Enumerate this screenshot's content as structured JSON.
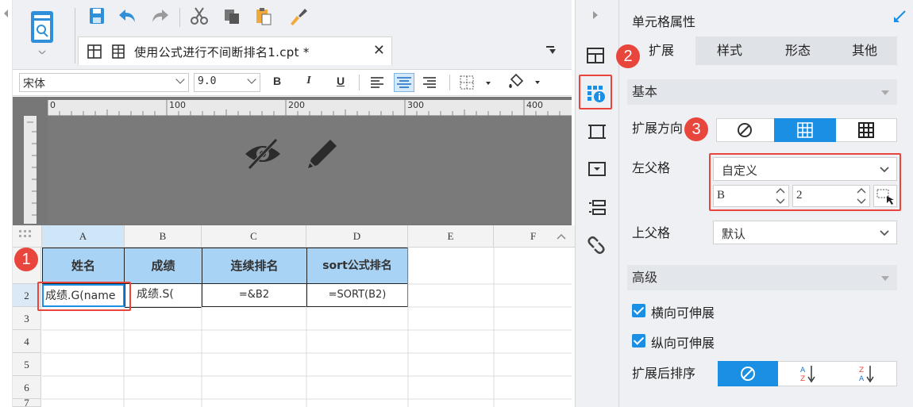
{
  "toolbar": {
    "tab_title": "使用公式进行不间断排名1.cpt *",
    "close_glyph": "✕"
  },
  "format": {
    "font_name": "宋体",
    "font_size": "9.0",
    "bold": "B",
    "italic": "I",
    "underline": "U"
  },
  "ruler": {
    "marks": [
      "0",
      "100",
      "200",
      "300",
      "400"
    ]
  },
  "grid": {
    "columns": [
      "A",
      "B",
      "C",
      "D",
      "E",
      "F"
    ],
    "rows": [
      "1",
      "2",
      "3",
      "4",
      "5",
      "6",
      "7"
    ],
    "header_row": [
      "姓名",
      "成绩",
      "连续排名",
      "sort公式排名"
    ],
    "data_row": [
      "成绩.G(name",
      "成绩.S(",
      "=&B2",
      "=SORT(B2)"
    ]
  },
  "panel": {
    "title": "单元格属性",
    "tabs": [
      "扩展",
      "样式",
      "形态",
      "其他"
    ],
    "basic_section": "基本",
    "expand_direction_label": "扩展方向",
    "left_parent_label": "左父格",
    "left_parent_value": "自定义",
    "left_parent_col": "B",
    "left_parent_row": "2",
    "top_parent_label": "上父格",
    "top_parent_value": "默认",
    "advanced_section": "高级",
    "horizontal_expand": "横向可伸展",
    "vertical_expand": "纵向可伸展",
    "sort_after_expand": "扩展后排序"
  },
  "badges": [
    "1",
    "2",
    "3"
  ],
  "colors": {
    "accent": "#1a8fe3",
    "header_fill": "#a9d3f5",
    "annotation_red": "#e8453c"
  }
}
